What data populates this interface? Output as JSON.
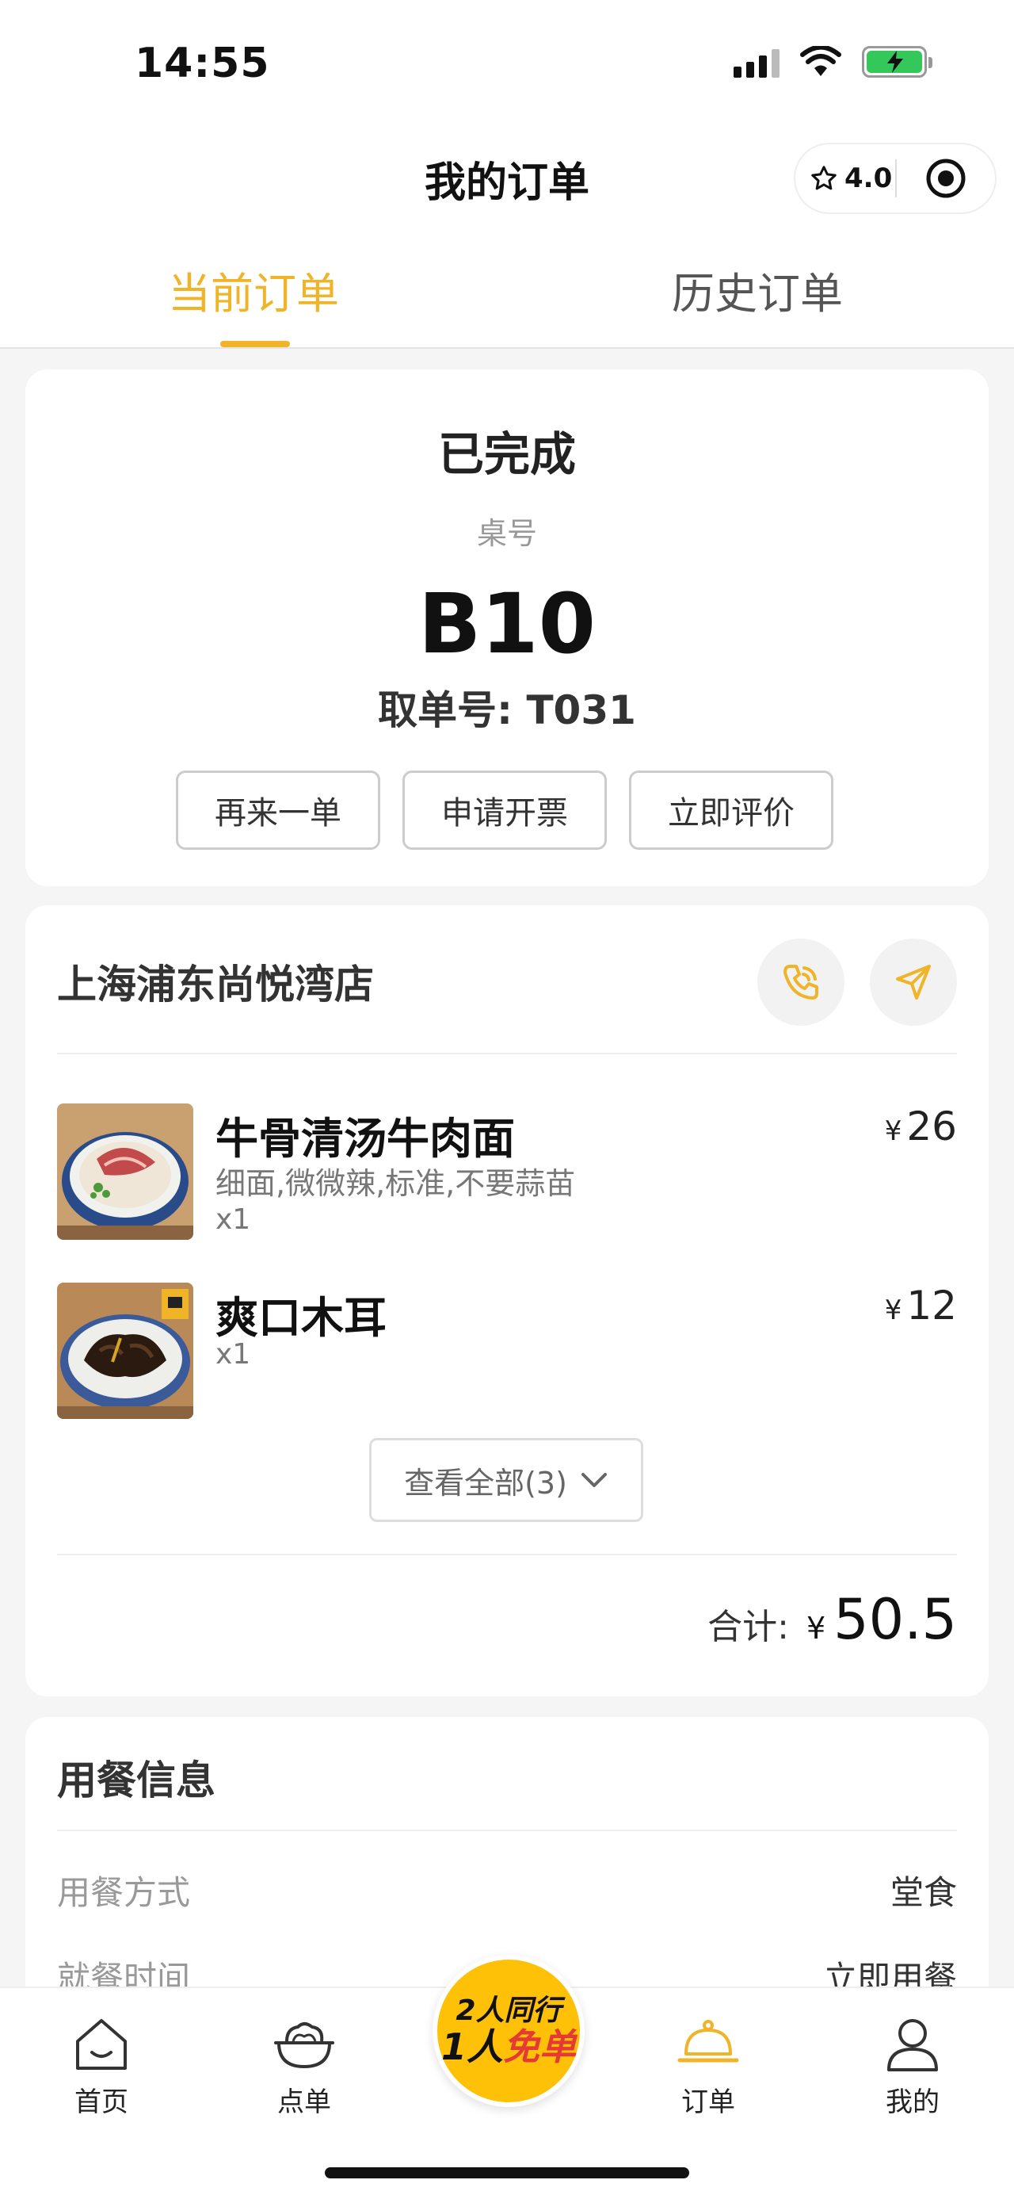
{
  "status_bar": {
    "time": "14:55"
  },
  "header": {
    "title": "我的订单",
    "rating": "4.0"
  },
  "tabs": [
    {
      "label": "当前订单",
      "active": true
    },
    {
      "label": "历史订单",
      "active": false
    }
  ],
  "order": {
    "status": "已完成",
    "table_label": "桌号",
    "table_number": "B10",
    "pickup_number": "取单号: T031",
    "actions": [
      "再来一单",
      "申请开票",
      "立即评价"
    ]
  },
  "store": {
    "name": "上海浦东尚悦湾店",
    "items": [
      {
        "name": "牛骨清汤牛肉面",
        "spec": "细面,微微辣,标准,不要蒜苗",
        "qty": "x1",
        "currency": "¥",
        "price": "26"
      },
      {
        "name": "爽口木耳",
        "spec": "",
        "qty": "x1",
        "currency": "¥",
        "price": "12"
      }
    ],
    "view_all": "查看全部(3)",
    "total_label": "合计:",
    "total_currency": "¥",
    "total_value": "50.5"
  },
  "dining": {
    "title": "用餐信息",
    "rows": [
      {
        "label": "用餐方式",
        "value": "堂食"
      },
      {
        "label": "就餐时间",
        "value": "立即用餐"
      }
    ]
  },
  "tabbar": {
    "items": [
      {
        "label": "首页",
        "icon": "home-icon"
      },
      {
        "label": "点单",
        "icon": "bowl-icon"
      },
      {
        "label": "订单",
        "icon": "cloche-icon",
        "active": true
      },
      {
        "label": "我的",
        "icon": "person-icon"
      }
    ],
    "promo_line1": "2人同行",
    "promo_line2a": "1人",
    "promo_line2b": "免单"
  },
  "colors": {
    "accent": "#f0b429",
    "promo": "#ffc107",
    "promo_red": "#e53935"
  }
}
